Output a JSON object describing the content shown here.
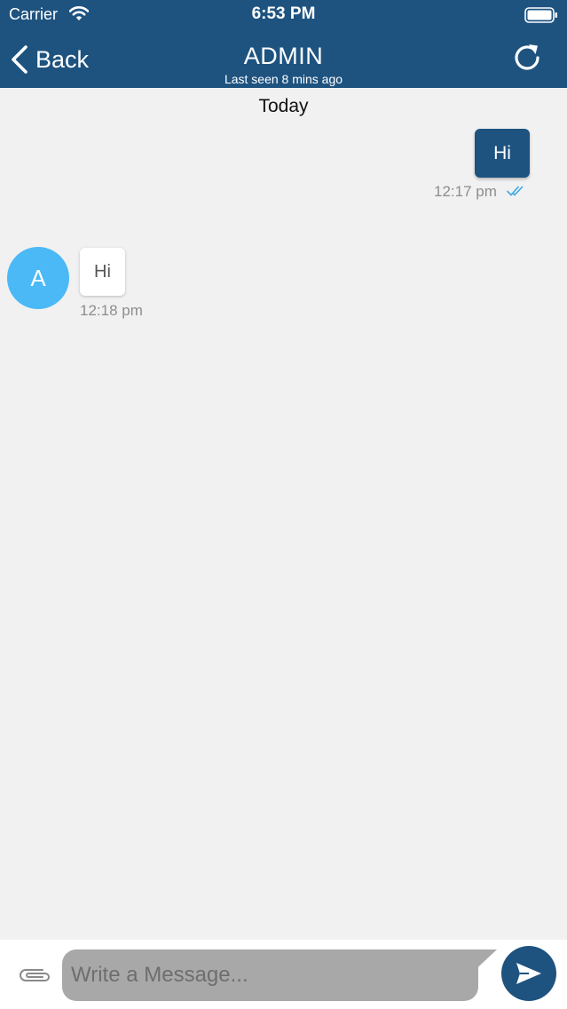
{
  "status_bar": {
    "carrier": "Carrier",
    "time": "6:53 PM"
  },
  "nav": {
    "back_label": "Back",
    "title": "ADMIN",
    "subtitle": "Last seen 8 mins ago"
  },
  "chat": {
    "date_divider": "Today",
    "messages": [
      {
        "direction": "outgoing",
        "text": "Hi",
        "time": "12:17 pm",
        "status": "read"
      },
      {
        "direction": "incoming",
        "sender_initial": "A",
        "text": "Hi",
        "time": "12:18 pm"
      }
    ]
  },
  "composer": {
    "placeholder": "Write a Message..."
  },
  "icons": {
    "back": "chevron-left-icon",
    "refresh": "refresh-icon",
    "read_status": "double-check-icon",
    "attach": "paperclip-icon",
    "send": "send-icon",
    "wifi": "wifi-icon",
    "battery": "battery-icon"
  },
  "colors": {
    "primary": "#1e5380",
    "avatar": "#4ab9f6",
    "background": "#f1f1f2",
    "read_check": "#3aa8e0",
    "input_background": "#a8a8a9",
    "timestamp": "#8d8d8d"
  }
}
